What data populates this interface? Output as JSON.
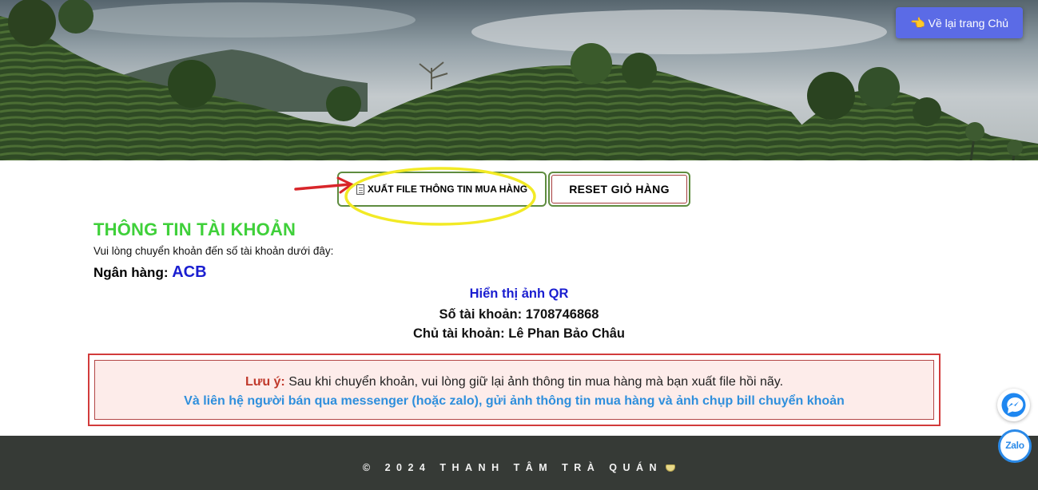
{
  "header": {
    "home_button_label": "Về lại trang Chủ",
    "home_button_icon": "pointing-hand-icon"
  },
  "actions": {
    "export_label": "XUẤT FILE THÔNG TIN MUA HÀNG",
    "export_icon": "document-icon",
    "reset_label": "RESET GIỎ HÀNG"
  },
  "account": {
    "title": "THÔNG TIN TÀI KHOẢN",
    "subtitle": "Vui lòng chuyển khoản đến số tài khoản dưới đây:",
    "bank_label": "Ngân hàng:",
    "bank_name": "ACB",
    "qr_link": "Hiển thị ảnh QR",
    "number_label": "Số tài khoản:",
    "number": "1708746868",
    "owner_label": "Chủ tài khoản:",
    "owner": "Lê Phan Bảo Châu"
  },
  "note": {
    "label": "Lưu ý:",
    "text": "Sau khi chuyển khoản, vui lòng giữ lại ảnh thông tin mua hàng mà bạn xuất file hồi nãy.",
    "line2": "Và liên hệ người bán qua messenger (hoặc zalo), gửi ảnh thông tin mua hàng và ảnh chụp bill chuyển khoản"
  },
  "footer": {
    "text": "© 2024 THANH TÂM TRÀ QUÁN"
  },
  "chat": {
    "messenger_icon": "messenger-icon",
    "zalo_label": "Zalo"
  },
  "colors": {
    "title_green": "#3fd03a",
    "bank_blue": "#1a1ed0",
    "note_red": "#c0392b",
    "note_blue": "#2f8fdc",
    "home_button": "#5b6be6",
    "footer_bg": "#363a36"
  }
}
